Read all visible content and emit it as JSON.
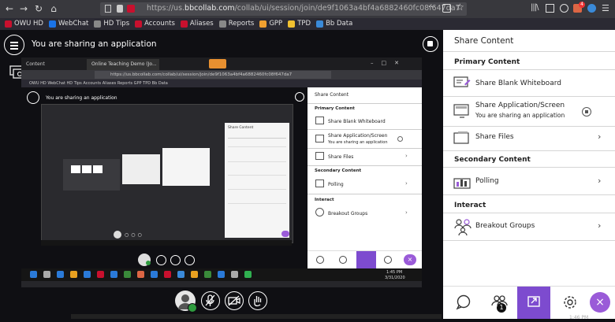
{
  "browser": {
    "url_scheme": "https://us.",
    "url_host": "bbcollab.com",
    "url_path": "/collab/ui/session/join/de9f1063a4bf4a6882460fc08f647da7",
    "menu_dots": "···",
    "badge_count": "4"
  },
  "bookmarks": [
    {
      "label": "OWU HD",
      "color": "#c8102e"
    },
    {
      "label": "WebChat",
      "color": "#1a73e8"
    },
    {
      "label": "HD Tips",
      "color": "#888888"
    },
    {
      "label": "Accounts",
      "color": "#c8102e"
    },
    {
      "label": "Aliases",
      "color": "#c8102e"
    },
    {
      "label": "Reports",
      "color": "#888888"
    },
    {
      "label": "GPP",
      "color": "#f0a030"
    },
    {
      "label": "TPD",
      "color": "#f0c030"
    },
    {
      "label": "Bb Data",
      "color": "#3a8ad8"
    }
  ],
  "stage": {
    "sharing_text": "You are sharing an application"
  },
  "inner": {
    "tab0": "Content",
    "tab1": "Online Teaching Demo (Jo...",
    "url": "https://us.bbcollab.com/collab/ui/session/join/de9f1063a4bf4a6882460fc08f647da7",
    "bookmarks": "OWU HD   WebChat   HD Tips   Accounts   Aliases   Reports   GPP   TPD   Bb Data",
    "sharing_text": "You are sharing an application",
    "panel_title": "Share Content",
    "primary": "Primary Content",
    "whiteboard": "Share Blank Whiteboard",
    "app": "Share Application/Screen",
    "app_sub": "You are sharing an application",
    "files": "Share Files",
    "secondary": "Secondary Content",
    "polling": "Polling",
    "interact": "Interact",
    "breakout": "Breakout Groups",
    "time": "1:45 PM",
    "date": "3/31/2020"
  },
  "panel": {
    "title": "Share Content",
    "primary_heading": "Primary Content",
    "whiteboard_label": "Share Blank Whiteboard",
    "app_label": "Share Application/Screen",
    "app_sub": "You are sharing an application",
    "files_label": "Share Files",
    "secondary_heading": "Secondary Content",
    "polling_label": "Polling",
    "interact_heading": "Interact",
    "breakout_label": "Breakout Groups",
    "attendee_badge": "1",
    "clock": "1:46 PM"
  },
  "colors": {
    "accent": "#7d4bcf",
    "close": "#9a5bd8",
    "status_ok": "#2e9b3e"
  }
}
